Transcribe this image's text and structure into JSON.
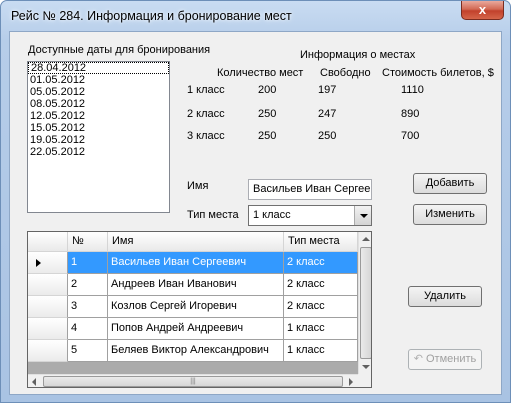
{
  "window": {
    "title": "Рейс № 284. Информация и бронирование мест",
    "close_glyph": "x"
  },
  "dates": {
    "label": "Доступные даты для бронирования",
    "items": [
      "28.04.2012",
      "01.05.2012",
      "05.05.2012",
      "08.05.2012",
      "12.05.2012",
      "15.05.2012",
      "19.05.2012",
      "22.05.2012"
    ],
    "selected_index": 0
  },
  "seats": {
    "title": "Информация о местах",
    "headers": {
      "count": "Количество мест",
      "free": "Свободно",
      "price": "Стоимость билетов, $"
    },
    "rows": [
      {
        "class": "1 класс",
        "count": "200",
        "free": "197",
        "price": "1110"
      },
      {
        "class": "2 класс",
        "count": "250",
        "free": "247",
        "price": "890"
      },
      {
        "class": "3 класс",
        "count": "250",
        "free": "250",
        "price": "700"
      }
    ]
  },
  "form": {
    "name_label": "Имя",
    "name_value": "Васильев Иван Сергеевич",
    "seat_type_label": "Тип места",
    "seat_type_value": "1 класс"
  },
  "buttons": {
    "add": "Добавить",
    "edit": "Изменить",
    "delete": "Удалить",
    "undo": "Отменить"
  },
  "grid": {
    "columns": [
      "№",
      "Имя",
      "Тип места"
    ],
    "rows": [
      {
        "num": "1",
        "name": "Васильев Иван Сергеевич",
        "type": "2 класс"
      },
      {
        "num": "2",
        "name": "Андреев Иван Иванович",
        "type": "2 класс"
      },
      {
        "num": "3",
        "name": "Козлов Сергей Игоревич",
        "type": "2 класс"
      },
      {
        "num": "4",
        "name": "Попов Андрей Андреевич",
        "type": "1 класс"
      },
      {
        "num": "5",
        "name": "Беляев Виктор Александрович",
        "type": "1 класс"
      }
    ],
    "selected_row": 0,
    "scroll_grip": "|||"
  },
  "colors": {
    "selection": "#3399ff",
    "title_bar": "#b6cde9",
    "close_button": "#c2412c"
  }
}
